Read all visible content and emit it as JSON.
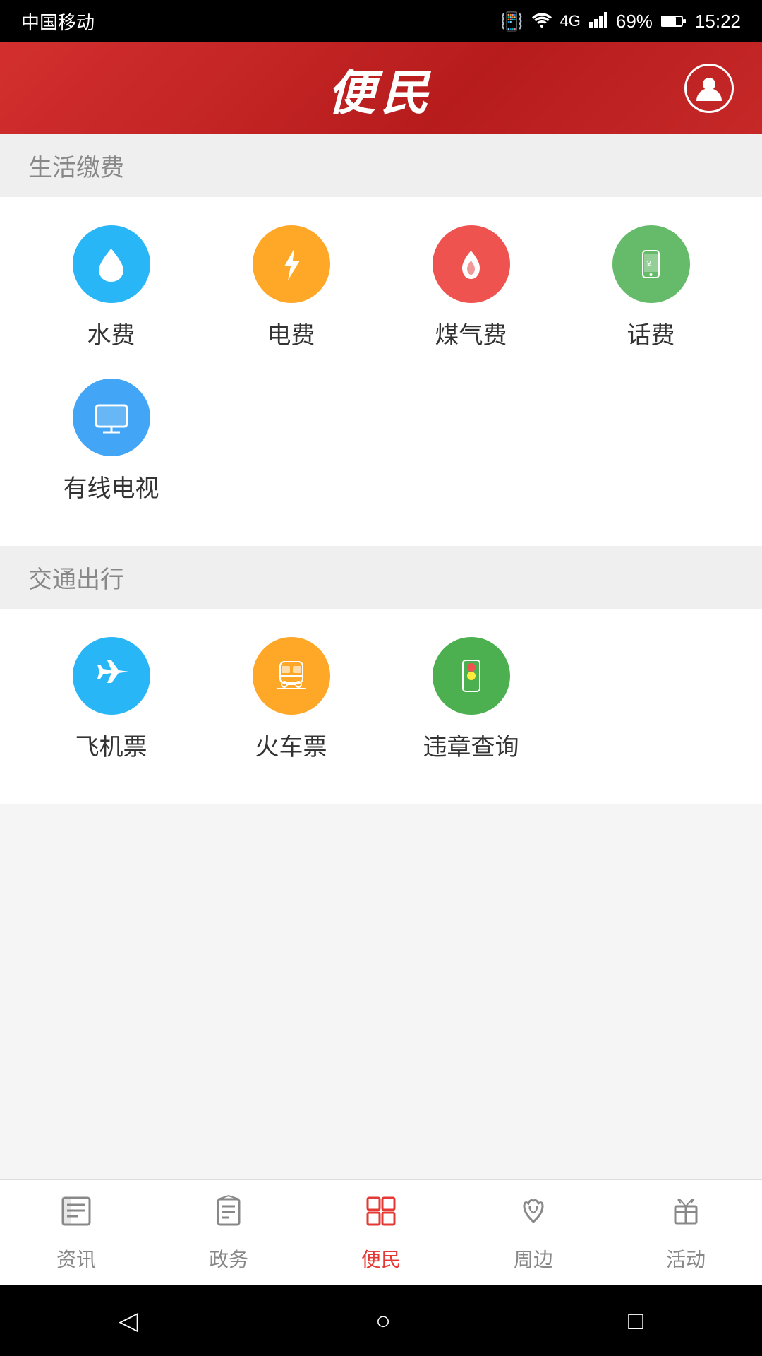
{
  "statusBar": {
    "carrier": "中国移动",
    "vibrate": "📳",
    "wifi": "WiFi",
    "signal4g": "4G",
    "signal": "69%",
    "battery": "69%",
    "time": "15:22"
  },
  "header": {
    "title": "便民",
    "avatarIcon": "👤"
  },
  "sections": [
    {
      "id": "life-payment",
      "label": "生活缴费",
      "items": [
        {
          "id": "water",
          "label": "水费",
          "iconColor": "icon-blue",
          "icon": "💧"
        },
        {
          "id": "electricity",
          "label": "电费",
          "iconColor": "icon-orange",
          "icon": "⚡"
        },
        {
          "id": "gas",
          "label": "煤气费",
          "iconColor": "icon-red",
          "icon": "🔥"
        },
        {
          "id": "phone",
          "label": "话费",
          "iconColor": "icon-green",
          "icon": "📱"
        }
      ],
      "items2": [
        {
          "id": "cable-tv",
          "label": "有线电视",
          "iconColor": "icon-blue2",
          "icon": "🖥"
        }
      ]
    },
    {
      "id": "transportation",
      "label": "交通出行",
      "items": [
        {
          "id": "flight",
          "label": "飞机票",
          "iconColor": "icon-blue",
          "icon": "✈"
        },
        {
          "id": "train",
          "label": "火车票",
          "iconColor": "icon-orange2",
          "icon": "🚂"
        },
        {
          "id": "violation",
          "label": "违章查询",
          "iconColor": "icon-green2",
          "icon": "🚦"
        }
      ]
    }
  ],
  "bottomNav": [
    {
      "id": "news",
      "label": "资讯",
      "icon": "📰",
      "active": false
    },
    {
      "id": "government",
      "label": "政务",
      "icon": "📋",
      "active": false
    },
    {
      "id": "convenient",
      "label": "便民",
      "icon": "⊞",
      "active": true
    },
    {
      "id": "nearby",
      "label": "周边",
      "icon": "☕",
      "active": false
    },
    {
      "id": "activity",
      "label": "活动",
      "icon": "🎁",
      "active": false
    }
  ],
  "systemNav": {
    "back": "◁",
    "home": "○",
    "recent": "□"
  }
}
